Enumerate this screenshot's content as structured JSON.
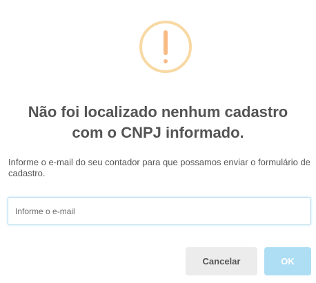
{
  "dialog": {
    "icon": "warning-icon",
    "title_line1": "Não foi localizado nenhum cadastro",
    "title_line2": "com o CNPJ informado.",
    "text": "Informe o e-mail do seu contador para que possamos enviar o formulário de cadastro.",
    "input": {
      "value": "",
      "placeholder": "Informe o e-mail"
    },
    "cancel_label": "Cancelar",
    "confirm_label": "OK"
  },
  "colors": {
    "warning_ring": "#f8d9a4",
    "warning_mark": "#f8bb86",
    "title_text": "#545454",
    "cancel_bg": "#ececec",
    "confirm_bg": "#aedef4",
    "input_border": "#b4dbed"
  }
}
